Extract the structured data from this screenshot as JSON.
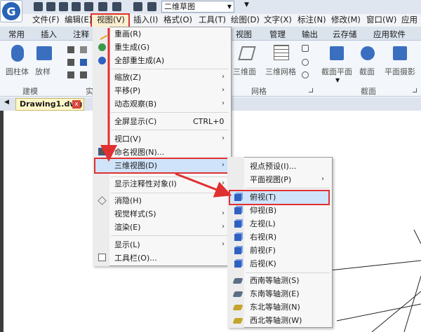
{
  "toolbar": {
    "workspace": "二维草图"
  },
  "menubar": {
    "items": [
      "文件(F)",
      "编辑(E)",
      "视图(V)",
      "插入(I)",
      "格式(O)",
      "工具(T)",
      "绘图(D)",
      "文字(X)",
      "标注(N)",
      "修改(M)",
      "窗口(W)",
      "应用"
    ]
  },
  "tabs": [
    "常用",
    "插入",
    "注释",
    "视图",
    "管理",
    "输出",
    "云存储",
    "应用软件"
  ],
  "ribbon": {
    "left_buttons": [
      "圆柱体",
      "放样"
    ],
    "group_model": "建模",
    "group_partial": "实",
    "mesh_buttons": [
      "三维面",
      "三维网格"
    ],
    "group_mesh": "网格",
    "section_buttons": [
      "截面平面",
      "截面",
      "平面摄影"
    ],
    "group_section": "截面"
  },
  "doc": {
    "tab": "Drawing1.dwg",
    "close": "x"
  },
  "view_menu": {
    "items": [
      "重画(R)",
      "重生成(G)",
      "全部重生成(A)",
      "缩放(Z)",
      "平移(P)",
      "动态观察(B)",
      "全屏显示(C)",
      "视口(V)",
      "命名视图(N)...",
      "三维视图(D)",
      "显示注释性对象(I)",
      "消隐(H)",
      "视觉样式(S)",
      "渲染(E)",
      "显示(L)",
      "工具栏(O)..."
    ],
    "shortcut": "CTRL+0"
  },
  "sub_menu": {
    "items": [
      "视点预设(I)...",
      "平面视图(P)",
      "俯视(T)",
      "仰视(B)",
      "左视(L)",
      "右视(R)",
      "前视(F)",
      "后视(K)",
      "西南等轴测(S)",
      "东南等轴测(E)",
      "东北等轴测(N)",
      "西北等轴测(W)"
    ]
  },
  "colors": {
    "highlight": "#e03030",
    "accent": "#2e61c2"
  }
}
